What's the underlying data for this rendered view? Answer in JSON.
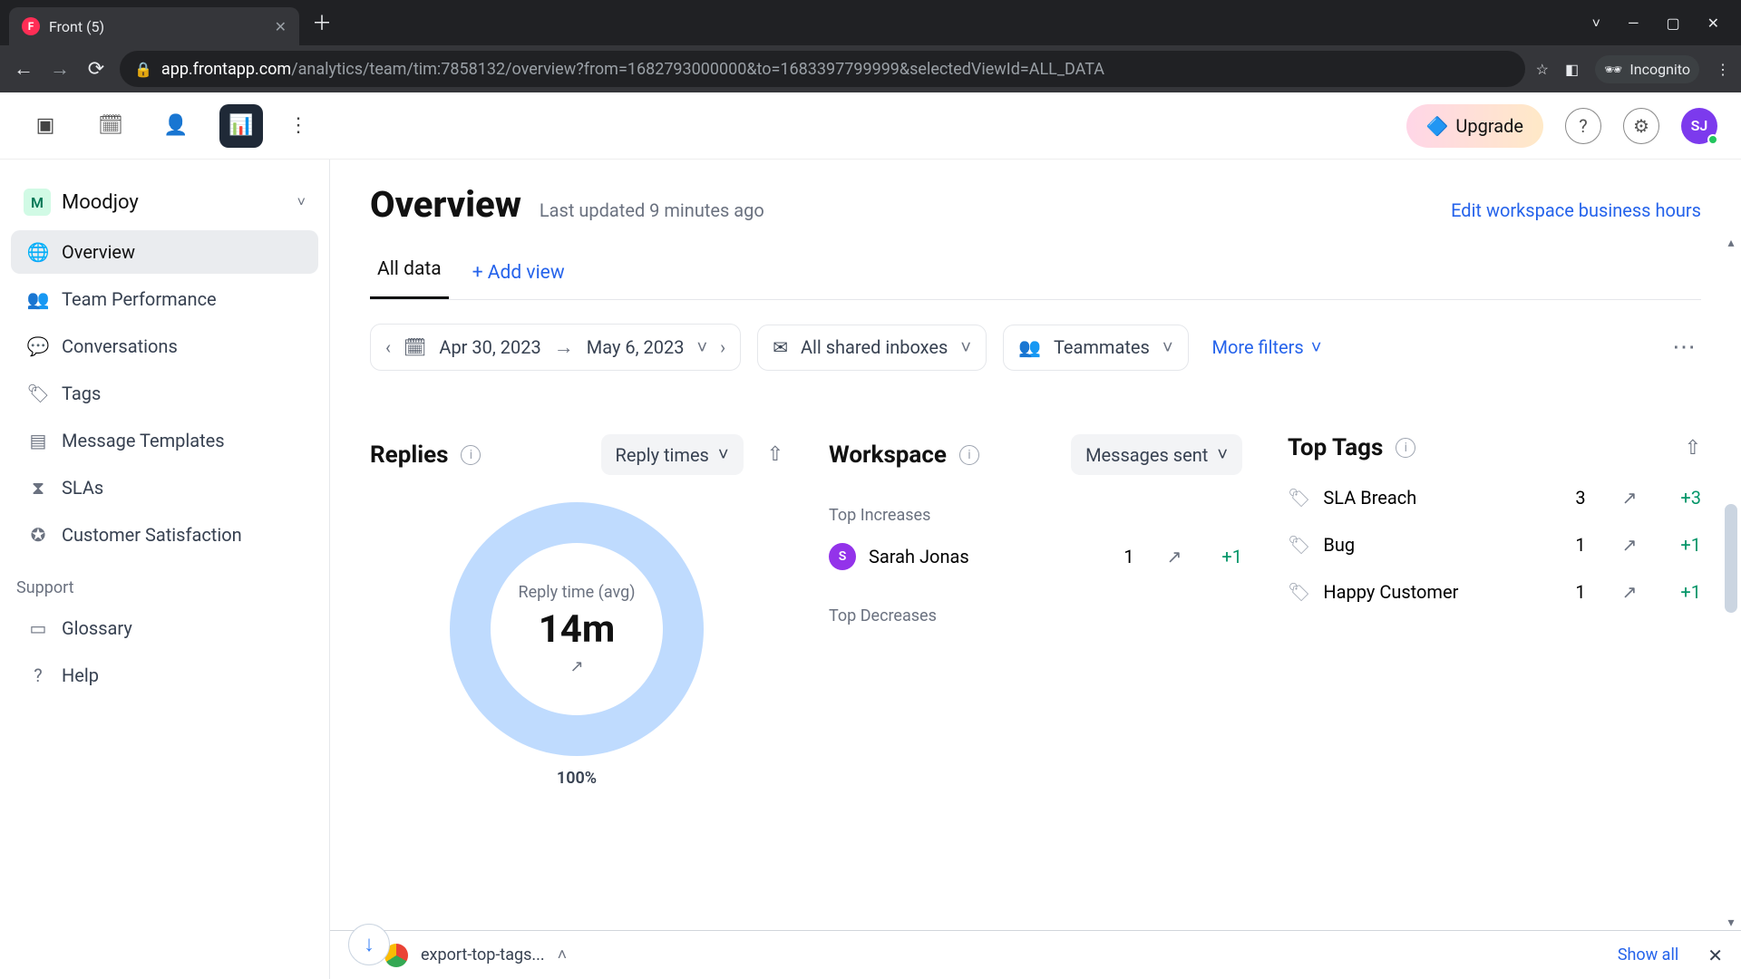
{
  "browser": {
    "tab_title": "Front (5)",
    "url_host": "app.frontapp.com",
    "url_path": "/analytics/team/tim:7858132/overview?from=1682793000000&to=1683397799999&selectedViewId=ALL_DATA",
    "incognito_label": "Incognito"
  },
  "win": {
    "chevron": "˅",
    "min": "—",
    "max": "▢",
    "close": "✕"
  },
  "topnav": {
    "upgrade": "Upgrade",
    "avatar_initials": "SJ"
  },
  "sidebar": {
    "workspace_initial": "M",
    "workspace_name": "Moodjoy",
    "items": [
      {
        "label": "Overview"
      },
      {
        "label": "Team Performance"
      },
      {
        "label": "Conversations"
      },
      {
        "label": "Tags"
      },
      {
        "label": "Message Templates"
      },
      {
        "label": "SLAs"
      },
      {
        "label": "Customer Satisfaction"
      }
    ],
    "support_heading": "Support",
    "support": [
      {
        "label": "Glossary"
      },
      {
        "label": "Help"
      }
    ]
  },
  "page": {
    "title": "Overview",
    "last_updated": "Last updated 9 minutes ago",
    "biz_hours_link": "Edit workspace business hours",
    "tab_all_data": "All data",
    "add_view": "+ Add view"
  },
  "filters": {
    "date_from": "Apr 30, 2023",
    "date_to": "May 6, 2023",
    "inboxes": "All shared inboxes",
    "teammates": "Teammates",
    "more": "More filters"
  },
  "replies": {
    "title": "Replies",
    "dropdown": "Reply times",
    "donut_label": "Reply time (avg)",
    "donut_value": "14m",
    "donut_pct": "100%"
  },
  "workspace": {
    "title": "Workspace",
    "dropdown": "Messages sent",
    "top_increases": "Top Increases",
    "top_decreases": "Top Decreases",
    "rows": [
      {
        "initial": "S",
        "name": "Sarah Jonas",
        "value": "1",
        "delta": "+1"
      }
    ]
  },
  "top_tags": {
    "title": "Top Tags",
    "rows": [
      {
        "name": "SLA Breach",
        "value": "3",
        "delta": "+3"
      },
      {
        "name": "Bug",
        "value": "1",
        "delta": "+1"
      },
      {
        "name": "Happy Customer",
        "value": "1",
        "delta": "+1"
      }
    ]
  },
  "download": {
    "filename": "export-top-tags...",
    "show_all": "Show all"
  },
  "chart_data": {
    "type": "pie",
    "title": "Reply time (avg)",
    "categories": [
      "Reply time (avg)"
    ],
    "values": [
      100
    ],
    "center_value": "14m",
    "unit": "percent"
  }
}
